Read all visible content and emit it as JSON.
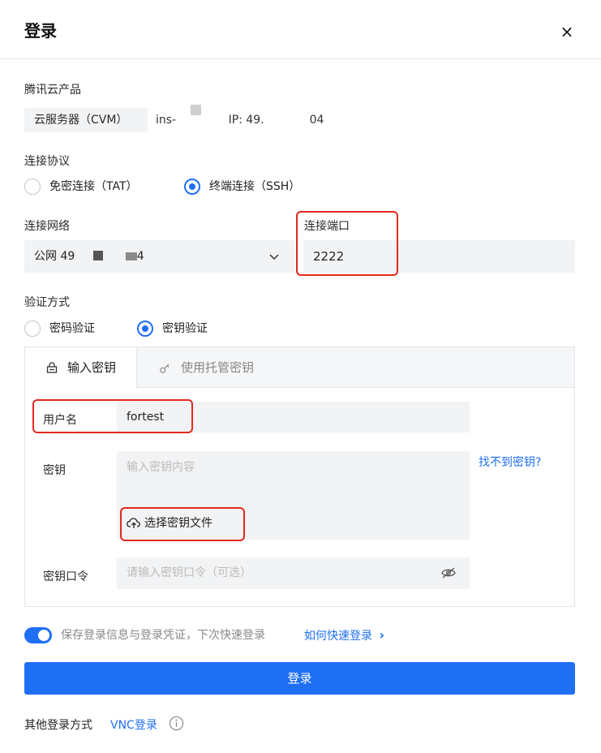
{
  "header": {
    "title": "登录",
    "close_icon": "×"
  },
  "product": {
    "label": "腾讯云产品",
    "chip": "云服务器（CVM）",
    "instance_prefix": "ins-",
    "ip_prefix": "IP: 49.",
    "ip_suffix": "04"
  },
  "protocol": {
    "label": "连接协议",
    "options": [
      {
        "label": "免密连接（TAT）",
        "checked": false
      },
      {
        "label": "终端连接（SSH）",
        "checked": true
      }
    ]
  },
  "network": {
    "label": "连接网络",
    "selected_prefix": "公网 49",
    "selected_suffix": "4"
  },
  "port": {
    "label": "连接端口",
    "value": "2222"
  },
  "auth": {
    "label": "验证方式",
    "options": [
      {
        "label": "密码验证",
        "checked": false
      },
      {
        "label": "密钥验证",
        "checked": true
      }
    ]
  },
  "key_tabs": {
    "input_key": "输入密钥",
    "managed_key": "使用托管密钥"
  },
  "form": {
    "username_label": "用户名",
    "username_value": "fortest",
    "key_label": "密钥",
    "key_placeholder": "输入密钥内容",
    "key_help_link": "找不到密钥?",
    "select_file": "选择密钥文件",
    "passphrase_label": "密钥口令",
    "passphrase_placeholder": "请输入密钥口令（可选）"
  },
  "remember": {
    "text": "保存登录信息与登录凭证，下次快速登录",
    "link": "如何快速登录",
    "link_arrow": "›",
    "enabled": true
  },
  "login_button": "登录",
  "other": {
    "label": "其他登录方式",
    "vnc_link": "VNC登录"
  },
  "colors": {
    "accent": "#1f6ff5",
    "highlight": "#e5281f",
    "field_bg": "#f2f3f5"
  }
}
